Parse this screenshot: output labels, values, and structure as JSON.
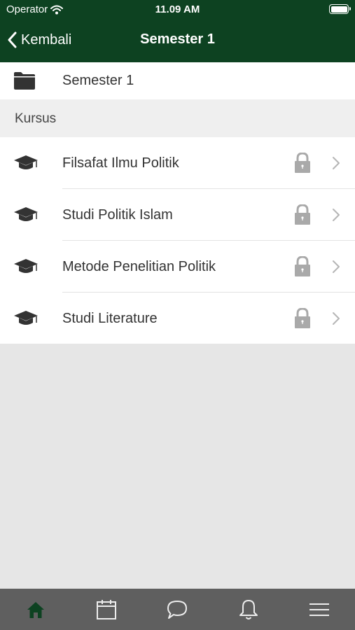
{
  "status_bar": {
    "carrier": "Operator",
    "time": "11.09 AM"
  },
  "nav": {
    "back_label": "Kembali",
    "title": "Semester 1"
  },
  "folder": {
    "label": "Semester 1",
    "icon": "folder-icon"
  },
  "section": {
    "title": "Kursus"
  },
  "courses": [
    {
      "label": "Filsafat Ilmu Politik",
      "icon": "graduation-cap-icon",
      "locked": true
    },
    {
      "label": "Studi Politik Islam",
      "icon": "graduation-cap-icon",
      "locked": true
    },
    {
      "label": "Metode Penelitian Politik",
      "icon": "graduation-cap-icon",
      "locked": true
    },
    {
      "label": "Studi Literature",
      "icon": "graduation-cap-icon",
      "locked": true
    }
  ],
  "tab_bar": {
    "tabs": [
      "home-icon",
      "calendar-icon",
      "chat-icon",
      "bell-icon",
      "menu-icon"
    ],
    "active": "home-icon"
  },
  "colors": {
    "header": "#0d4221",
    "active_tab": "#0d4221",
    "tab_bar": "#5f5f5f",
    "lock": "#a9a9a9"
  }
}
